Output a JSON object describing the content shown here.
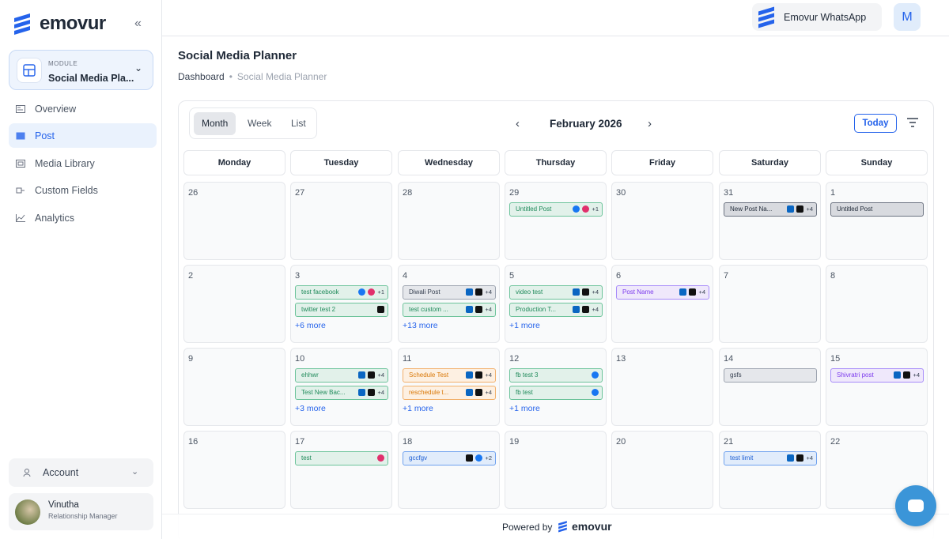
{
  "app": {
    "brand": "emovur"
  },
  "sidebar": {
    "module_label": "MODULE",
    "module_value": "Social Media Pla...",
    "nav": [
      {
        "label": "Overview",
        "icon": "overview-icon"
      },
      {
        "label": "Post",
        "icon": "post-icon",
        "active": true
      },
      {
        "label": "Media Library",
        "icon": "media-icon"
      },
      {
        "label": "Custom Fields",
        "icon": "fields-icon"
      },
      {
        "label": "Analytics",
        "icon": "analytics-icon"
      }
    ],
    "account_label": "Account",
    "user": {
      "name": "Vinutha",
      "role": "Relationship Manager"
    }
  },
  "topbar": {
    "whatsapp_label": "Emovur WhatsApp",
    "avatar_letter": "M"
  },
  "page": {
    "title": "Social Media Planner",
    "breadcrumb_root": "Dashboard",
    "breadcrumb_current": "Social Media Planner"
  },
  "calendar": {
    "views": [
      "Month",
      "Week",
      "List"
    ],
    "active_view": "Month",
    "month_label": "February 2026",
    "today_label": "Today",
    "weekdays": [
      "Monday",
      "Tuesday",
      "Wednesday",
      "Thursday",
      "Friday",
      "Saturday",
      "Sunday"
    ],
    "weeks": [
      [
        {
          "day": "26",
          "events": []
        },
        {
          "day": "27",
          "events": []
        },
        {
          "day": "28",
          "events": []
        },
        {
          "day": "29",
          "events": [
            {
              "title": "Untitled Post",
              "color": "green",
              "icons": [
                "facebook",
                "instagram"
              ],
              "extra": "+1"
            }
          ]
        },
        {
          "day": "30",
          "events": []
        },
        {
          "day": "31",
          "events": [
            {
              "title": "New Post Na...",
              "color": "gray2",
              "icons": [
                "linkedin",
                "x"
              ],
              "extra": "+4"
            }
          ]
        },
        {
          "day": "1",
          "events": [
            {
              "title": "Untitled Post",
              "color": "gray2",
              "icons": [],
              "extra": ""
            }
          ]
        }
      ],
      [
        {
          "day": "2",
          "events": []
        },
        {
          "day": "3",
          "events": [
            {
              "title": "test facebook",
              "color": "green",
              "icons": [
                "facebook",
                "instagram"
              ],
              "extra": "+1"
            },
            {
              "title": "twitter test 2",
              "color": "green",
              "icons": [
                "x"
              ],
              "extra": ""
            }
          ],
          "more": "+6 more"
        },
        {
          "day": "4",
          "events": [
            {
              "title": "Diwali Post",
              "color": "gray",
              "icons": [
                "linkedin",
                "x"
              ],
              "extra": "+4"
            },
            {
              "title": "test custom ...",
              "color": "green",
              "icons": [
                "linkedin",
                "x"
              ],
              "extra": "+4"
            }
          ],
          "more": "+13 more"
        },
        {
          "day": "5",
          "events": [
            {
              "title": "video test",
              "color": "green",
              "icons": [
                "linkedin",
                "x"
              ],
              "extra": "+4"
            },
            {
              "title": "Production T...",
              "color": "green",
              "icons": [
                "linkedin",
                "x"
              ],
              "extra": "+4"
            }
          ],
          "more": "+1 more"
        },
        {
          "day": "6",
          "events": [
            {
              "title": "Post Name",
              "color": "purple",
              "icons": [
                "linkedin",
                "x"
              ],
              "extra": "+4"
            }
          ]
        },
        {
          "day": "7",
          "events": []
        },
        {
          "day": "8",
          "events": []
        }
      ],
      [
        {
          "day": "9",
          "events": []
        },
        {
          "day": "10",
          "events": [
            {
              "title": "ehhwr",
              "color": "green",
              "icons": [
                "linkedin",
                "x"
              ],
              "extra": "+4"
            },
            {
              "title": "Test New Bac...",
              "color": "green",
              "icons": [
                "linkedin",
                "x"
              ],
              "extra": "+4"
            }
          ],
          "more": "+3 more"
        },
        {
          "day": "11",
          "events": [
            {
              "title": "Schedule Test",
              "color": "orange",
              "icons": [
                "linkedin",
                "x"
              ],
              "extra": "+4"
            },
            {
              "title": "reschedule t...",
              "color": "orange",
              "icons": [
                "linkedin",
                "x"
              ],
              "extra": "+4"
            }
          ],
          "more": "+1 more"
        },
        {
          "day": "12",
          "events": [
            {
              "title": "fb test 3",
              "color": "green",
              "icons": [
                "facebook"
              ],
              "extra": ""
            },
            {
              "title": "fb test",
              "color": "green",
              "icons": [
                "facebook"
              ],
              "extra": ""
            }
          ],
          "more": "+1 more"
        },
        {
          "day": "13",
          "events": []
        },
        {
          "day": "14",
          "events": [
            {
              "title": "gsfs",
              "color": "gray",
              "icons": [],
              "extra": ""
            }
          ]
        },
        {
          "day": "15",
          "events": [
            {
              "title": "Shivratri post",
              "color": "purple",
              "icons": [
                "linkedin",
                "x"
              ],
              "extra": "+4"
            }
          ]
        }
      ],
      [
        {
          "day": "16",
          "events": []
        },
        {
          "day": "17",
          "events": [
            {
              "title": "test",
              "color": "green",
              "icons": [
                "instagram"
              ],
              "extra": ""
            }
          ]
        },
        {
          "day": "18",
          "events": [
            {
              "title": "gccfgv",
              "color": "blue",
              "icons": [
                "x",
                "facebook"
              ],
              "extra": "+2"
            }
          ]
        },
        {
          "day": "19",
          "events": []
        },
        {
          "day": "20",
          "events": []
        },
        {
          "day": "21",
          "events": [
            {
              "title": "test limit",
              "color": "blue",
              "icons": [
                "linkedin",
                "x"
              ],
              "extra": "+4"
            }
          ]
        },
        {
          "day": "22",
          "events": []
        }
      ]
    ]
  },
  "footer": {
    "powered_by": "Powered by",
    "brand": "emovur"
  },
  "colors": {
    "accent": "#2563eb",
    "facebook": "#1877f2",
    "instagram": "#e1306c",
    "linkedin": "#0a66c2",
    "x": "#111111"
  }
}
